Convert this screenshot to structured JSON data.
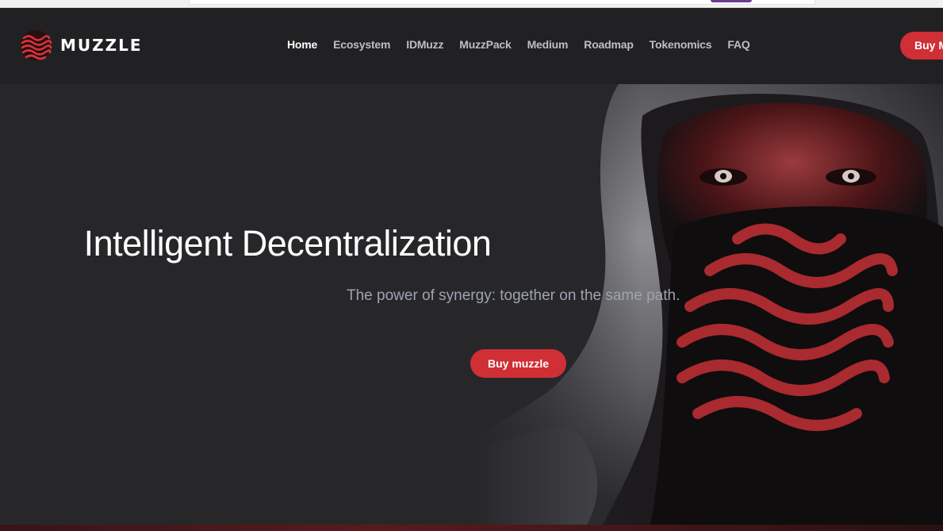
{
  "brand": {
    "name": "MUZZLE",
    "accent": "#cf2f35"
  },
  "nav": {
    "items": [
      {
        "label": "Home",
        "active": true
      },
      {
        "label": "Ecosystem",
        "active": false
      },
      {
        "label": "IDMuzz",
        "active": false
      },
      {
        "label": "MuzzPack",
        "active": false
      },
      {
        "label": "Medium",
        "active": false
      },
      {
        "label": "Roadmap",
        "active": false
      },
      {
        "label": "Tokenomics",
        "active": false
      },
      {
        "label": "FAQ",
        "active": false
      }
    ],
    "buy_label": "Buy M"
  },
  "hero": {
    "title": "Intelligent Decentralization",
    "subtitle": "The power of synergy: together on the same path.",
    "cta_label": "Buy muzzle"
  },
  "icons": {
    "logo": "muzzle-wave-logo-icon",
    "hero_image": "hooded-figure-with-red-wave-mask"
  }
}
